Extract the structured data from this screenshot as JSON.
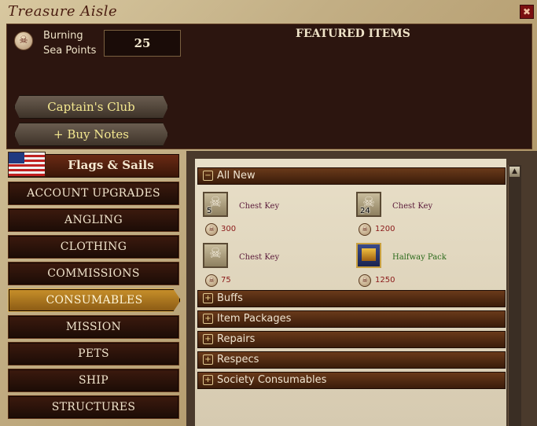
{
  "window": {
    "title": "Treasure Aisle",
    "close_icon": "close-icon"
  },
  "points": {
    "label_line1": "Burning",
    "label_line2": "Sea Points",
    "value": "25"
  },
  "featured_title": "FEATURED ITEMS",
  "buttons": {
    "captains_club": "Captain's Club",
    "buy_notes": "+ Buy Notes"
  },
  "flags_tab": {
    "label": "Flags & Sails"
  },
  "categories": [
    {
      "label": "ACCOUNT UPGRADES"
    },
    {
      "label": "ANGLING"
    },
    {
      "label": "CLOTHING"
    },
    {
      "label": "COMMISSIONS"
    },
    {
      "label": "CONSUMABLES",
      "active": true
    },
    {
      "label": "MISSION"
    },
    {
      "label": "PETS"
    },
    {
      "label": "SHIP"
    },
    {
      "label": "STRUCTURES"
    }
  ],
  "sections": {
    "all_new": {
      "label": "All New",
      "toggle": "−",
      "expanded": true
    },
    "collapsed": [
      {
        "label": "Buffs",
        "toggle": "+"
      },
      {
        "label": "Item Packages",
        "toggle": "+"
      },
      {
        "label": "Repairs",
        "toggle": "+"
      },
      {
        "label": "Respecs",
        "toggle": "+"
      },
      {
        "label": "Society Consumables",
        "toggle": "+"
      }
    ]
  },
  "items": [
    {
      "name": "Chest Key",
      "qty": "5",
      "price": "300",
      "icon": "key-icon"
    },
    {
      "name": "Chest Key",
      "qty": "24",
      "price": "1200",
      "icon": "key-icon"
    },
    {
      "name": "Chest Key",
      "qty": "",
      "price": "75",
      "icon": "key-icon"
    },
    {
      "name": "Halfway Pack",
      "qty": "",
      "price": "1250",
      "icon": "chest-icon"
    }
  ],
  "colors": {
    "accent_active": "#c8902a",
    "item_name": "#5a1a3a",
    "item_name_special": "#2a6a1a",
    "price": "#8a1818"
  }
}
